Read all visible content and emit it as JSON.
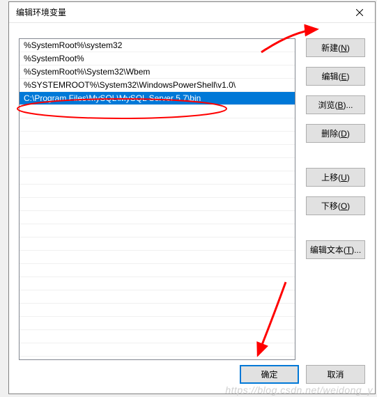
{
  "window": {
    "title": "编辑环境变量"
  },
  "list": {
    "items": [
      {
        "value": "%SystemRoot%\\system32",
        "selected": false
      },
      {
        "value": "%SystemRoot%",
        "selected": false
      },
      {
        "value": "%SystemRoot%\\System32\\Wbem",
        "selected": false
      },
      {
        "value": "%SYSTEMROOT%\\System32\\WindowsPowerShell\\v1.0\\",
        "selected": false
      },
      {
        "value": "C:\\Program Files\\MySQL\\MySQL Server 5.7\\bin",
        "selected": true
      }
    ]
  },
  "buttons": {
    "new": "新建(N)",
    "edit": "编辑(E)",
    "browse": "浏览(B)...",
    "delete": "删除(D)",
    "moveup": "上移(U)",
    "movedown": "下移(O)",
    "edittext": "编辑文本(T)...",
    "ok": "确定",
    "cancel": "取消"
  },
  "watermark": "https://blog.csdn.net/weidong_y"
}
